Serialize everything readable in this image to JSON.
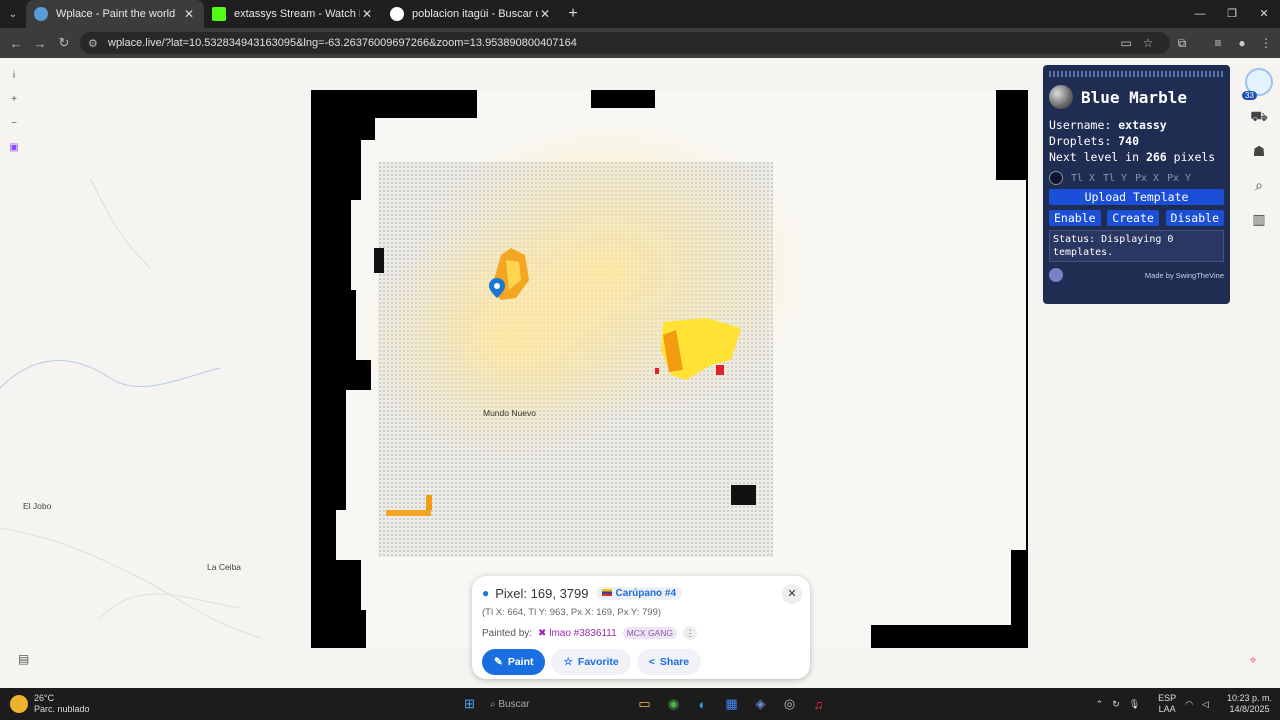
{
  "tabs": [
    {
      "title": "Wplace - Paint the world",
      "color": "#5b9bd5",
      "active": true
    },
    {
      "title": "extassys Stream - Watch Live o",
      "color": "#53fc18",
      "active": false
    },
    {
      "title": "poblacion itagüi - Buscar con G",
      "color": "#ffffff",
      "active": false
    }
  ],
  "address": {
    "url": "wplace.live/?lat=10.532834943163095&lng=-63.26376009697266&zoom=13.953890800407164"
  },
  "map": {
    "labels": {
      "mundo_nuevo": "Mundo Nuevo",
      "el_jobo": "El Jobo",
      "la_ceiba": "La Ceiba"
    }
  },
  "blue_marble": {
    "title": "Blue Marble",
    "username_label": "Username:",
    "username": "extassy",
    "droplets_label": "Droplets:",
    "droplets": "740",
    "next_level_prefix": "Next level in",
    "next_level_value": "266",
    "next_level_suffix": "pixels",
    "coord_placeholders": [
      "Tl X",
      "Tl Y",
      "Px X",
      "Px Y"
    ],
    "upload_template": "Upload Template",
    "enable": "Enable",
    "create": "Create",
    "disable": "Disable",
    "status": "Status: Displaying 0 templates.",
    "made_by": "Made by SwingTheVine"
  },
  "right_badge": "33",
  "pixel_panel": {
    "pixel_text": "Pixel: 169, 3799",
    "region_chip": "Carúpano #4",
    "tile_info": "(Tl X: 664, Tl Y: 963, Px X: 169, Px Y: 799)",
    "painted_by_label": "Painted by:",
    "painter": "lmao #3836111",
    "gang": "MCX GANG",
    "paint_button": "Paint",
    "favorite_button": "Favorite",
    "share_button": "Share"
  },
  "taskbar": {
    "temperature": "26°C",
    "weather": "Parc. nublado",
    "search_placeholder": "Buscar",
    "lang_top": "ESP",
    "lang_bottom": "LAA",
    "time": "10:23 p. m.",
    "date": "14/8/2025"
  }
}
